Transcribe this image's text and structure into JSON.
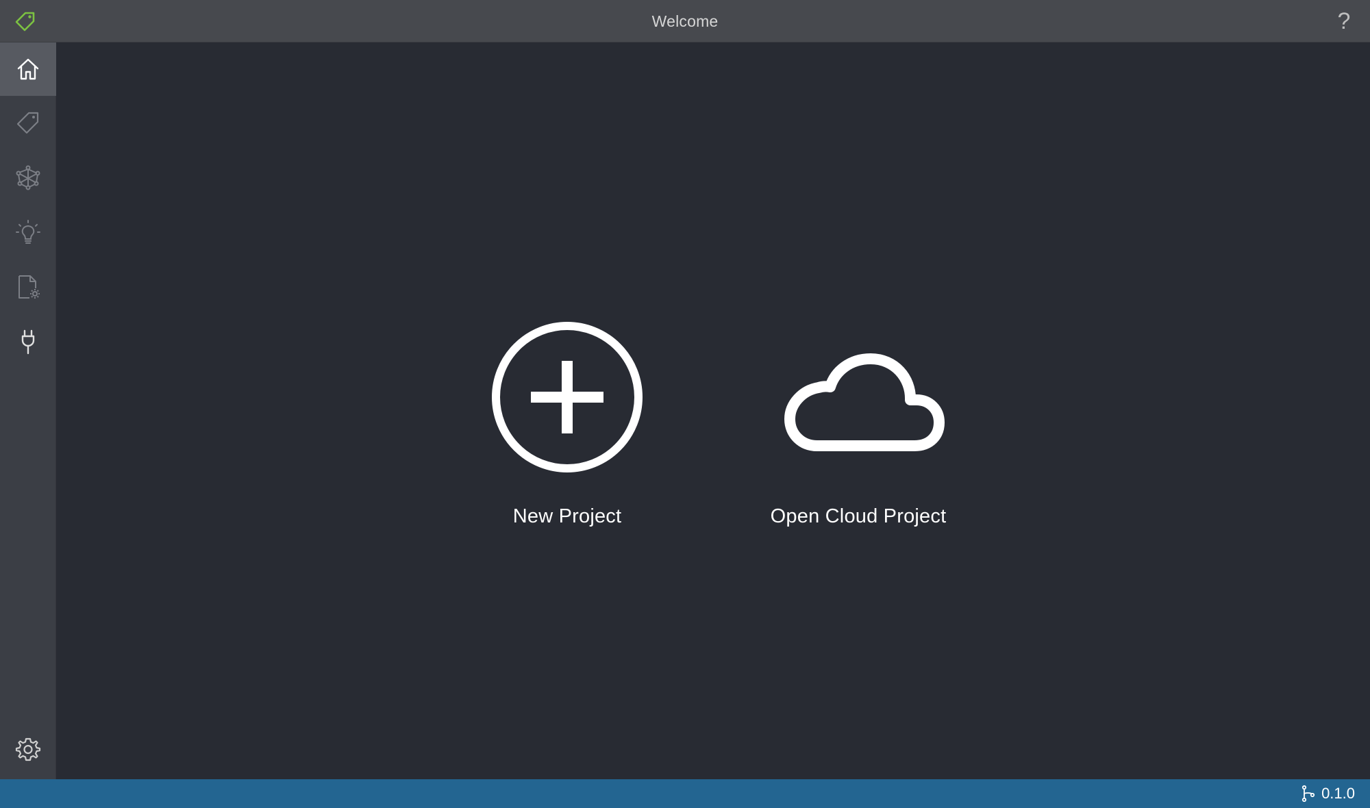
{
  "window": {
    "title": "Welcome",
    "help_label": "?"
  },
  "sidebar": {
    "items": [
      {
        "name": "home",
        "icon": "home-icon",
        "active": true
      },
      {
        "name": "tag",
        "icon": "tag-icon",
        "active": false
      },
      {
        "name": "network",
        "icon": "network-icon",
        "active": false
      },
      {
        "name": "ideas",
        "icon": "lightbulb-icon",
        "active": false
      },
      {
        "name": "file-settings",
        "icon": "file-settings-icon",
        "active": false
      },
      {
        "name": "connections",
        "icon": "plug-icon",
        "active": false
      }
    ],
    "bottom": {
      "name": "settings",
      "icon": "gear-icon"
    }
  },
  "main": {
    "actions": [
      {
        "label": "New Project",
        "icon": "plus-circle-icon"
      },
      {
        "label": "Open Cloud Project",
        "icon": "cloud-icon"
      }
    ]
  },
  "statusbar": {
    "version": "0.1.0",
    "version_icon": "git-branch-icon"
  },
  "colors": {
    "titlebar": "#47494e",
    "sidebar": "#3b3e45",
    "sidebar_active": "#575a61",
    "main_bg": "#282b33",
    "statusbar": "#236591",
    "logo_accent": "#7cc242"
  }
}
